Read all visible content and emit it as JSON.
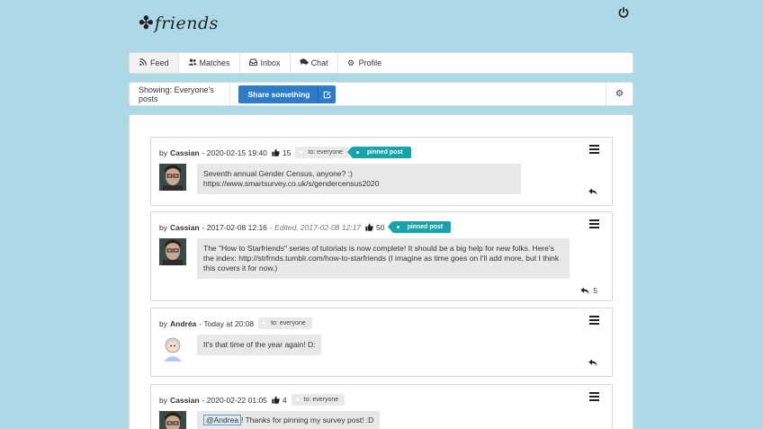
{
  "brand": {
    "logo_text": "friends",
    "logo_icon": "clover-icon"
  },
  "header": {
    "power_icon": "power-icon"
  },
  "nav": {
    "tabs": [
      {
        "label": "Feed",
        "icon": "rss-icon",
        "active": true
      },
      {
        "label": "Matches",
        "icon": "users-icon"
      },
      {
        "label": "Inbox",
        "icon": "inbox-icon"
      },
      {
        "label": "Chat",
        "icon": "chat-icon"
      },
      {
        "label": "Profile",
        "icon": "gear-icon"
      }
    ]
  },
  "toolbar": {
    "showing": "Showing: Everyone's posts",
    "share_label": "Share something",
    "share_icon": "edit-icon",
    "settings_icon": "gear-icon"
  },
  "posts": [
    {
      "by": "by",
      "author": "Cassian",
      "date": "- 2020-02-15 19:40",
      "edited": "",
      "likes": "15",
      "to": "to: everyone",
      "pinned": "pinned post",
      "text": "Seventh annual Gender Census, anyone? :) https://www.smartsurvey.co.uk/s/gendercensus2020",
      "replies": ""
    },
    {
      "by": "by",
      "author": "Cassian",
      "date": "- 2017-02-08 12:16",
      "edited": "- Edited, 2017-02-08 12:17",
      "likes": "50",
      "to": "",
      "pinned": "pinned post",
      "text": "The \"How to Starfriends\" series of tutorials is now complete! It should be a big help for new folks. Here's the index: http://strfrnds.tumblr.com/how-to-starfriends (I imagine as time goes on I'll add more, but I think this covers it for now.)",
      "replies": "5"
    },
    {
      "by": "by",
      "author": "Andréa",
      "date": "- Today at 20:08",
      "edited": "",
      "likes": "",
      "to": "to: everyone",
      "pinned": "",
      "text": "It's that time of the year again! D:",
      "replies": ""
    },
    {
      "by": "by",
      "author": "Cassian",
      "date": "- 2020-02-22 01:05",
      "edited": "",
      "likes": "4",
      "to": "to: everyone",
      "pinned": "",
      "mention": "@Andrea",
      "text": "! Thanks for pinning my survey post! :D",
      "replies": ""
    }
  ],
  "colors": {
    "background": "#add8e6",
    "primary": "#2e7bc9",
    "pinned": "#17a4a8"
  }
}
